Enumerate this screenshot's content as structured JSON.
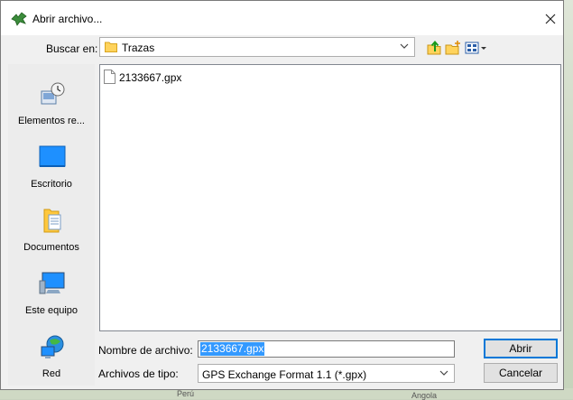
{
  "window": {
    "title": "Abrir archivo..."
  },
  "lookin": {
    "label": "Buscar en:",
    "value": "Trazas"
  },
  "places": [
    {
      "label": "Elementos re...",
      "icon": "recent-items-icon"
    },
    {
      "label": "Escritorio",
      "icon": "desktop-icon"
    },
    {
      "label": "Documentos",
      "icon": "documents-icon"
    },
    {
      "label": "Este equipo",
      "icon": "computer-icon"
    },
    {
      "label": "Red",
      "icon": "network-icon"
    }
  ],
  "files": [
    {
      "name": "2133667.gpx",
      "icon": "file-icon"
    }
  ],
  "filename": {
    "label": "Nombre de archivo:",
    "value": "2133667.gpx"
  },
  "filetype": {
    "label": "Archivos de tipo:",
    "value": "GPS Exchange Format 1.1 (*.gpx)"
  },
  "buttons": {
    "open": "Abrir",
    "cancel": "Cancelar"
  },
  "map": {
    "label_peru": "Perú",
    "label_angola": "Angola"
  },
  "colors": {
    "selection": "#3399ff",
    "accent": "#0078d7",
    "folder": "#ffd35c"
  }
}
